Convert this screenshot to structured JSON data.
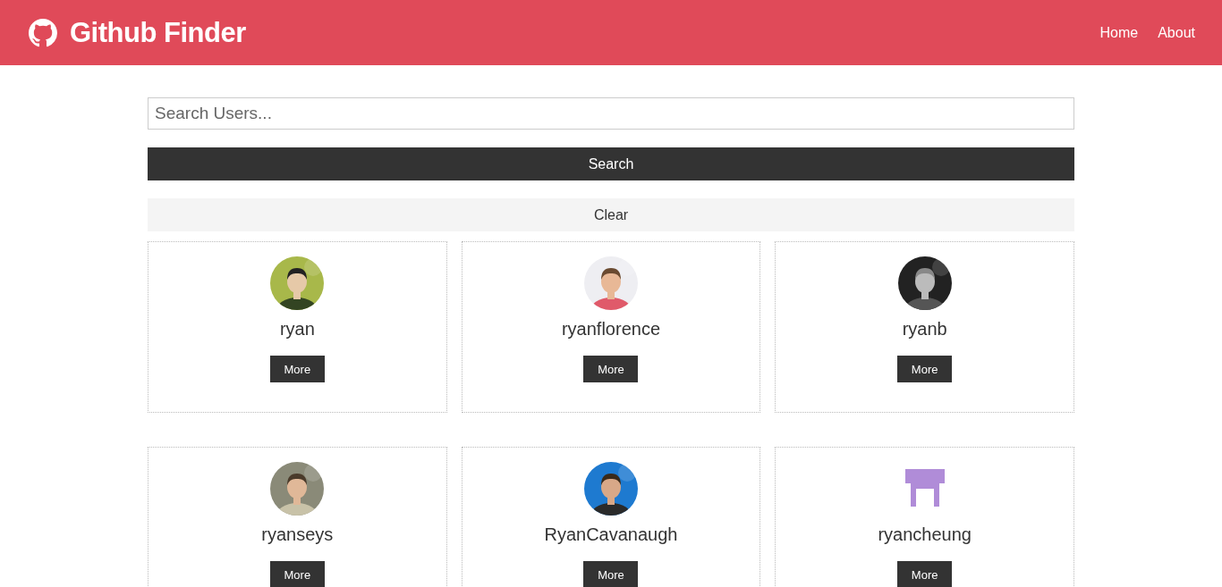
{
  "navbar": {
    "title": "Github Finder",
    "links": [
      {
        "label": "Home"
      },
      {
        "label": "About"
      }
    ]
  },
  "search": {
    "placeholder": "Search Users...",
    "submit": "Search",
    "clear": "Clear"
  },
  "users": [
    {
      "login": "ryan",
      "button": "More"
    },
    {
      "login": "ryanflorence",
      "button": "More"
    },
    {
      "login": "ryanb",
      "button": "More"
    },
    {
      "login": "ryanseys",
      "button": "More"
    },
    {
      "login": "RyanCavanaugh",
      "button": "More"
    },
    {
      "login": "ryancheung",
      "kind": "identicon",
      "button": "More"
    }
  ]
}
